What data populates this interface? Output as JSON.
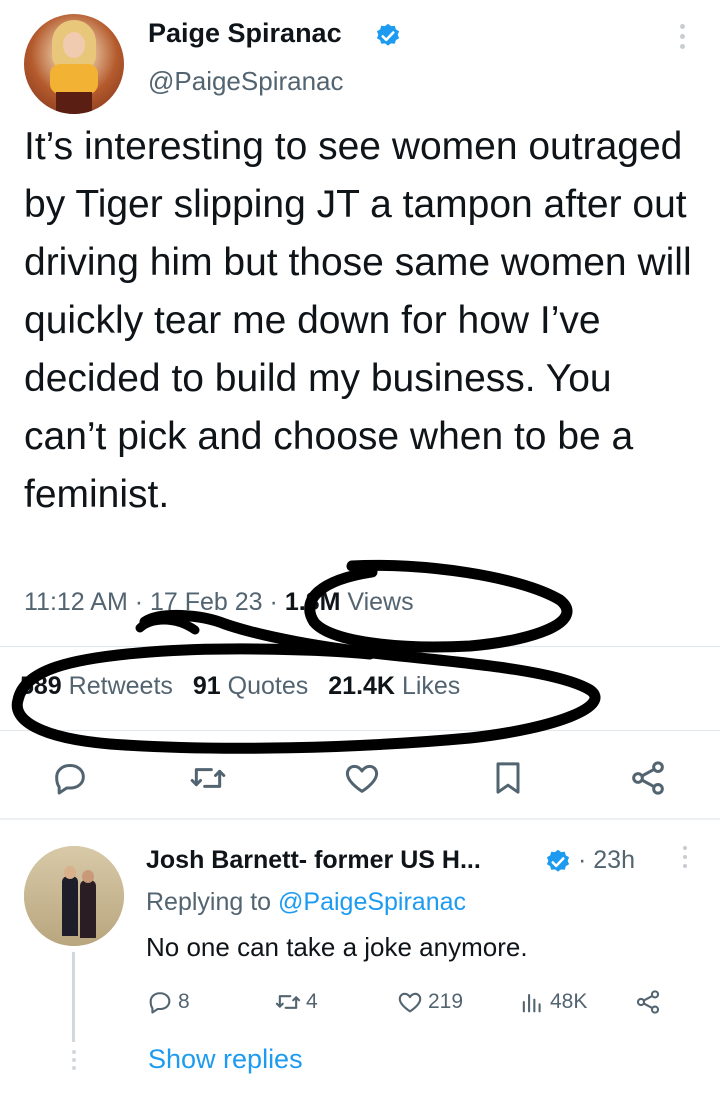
{
  "tweet": {
    "author_name": "Paige Spiranac",
    "handle": "@PaigeSpiranac",
    "text": "It’s interesting to see women outraged by Tiger slipping JT a tampon after out driving him but those same women will quickly tear me down for how I’ve decided to build my business. You can’t pick and choose when to be a feminist.",
    "time": "11:12 AM",
    "date_sep": " · ",
    "date": "17 Feb 23",
    "views_count": "1.8M",
    "views_label": "Views",
    "retweets_count": "589",
    "retweets_label": "Retweets",
    "quotes_count": "91",
    "quotes_label": "Quotes",
    "likes_count": "21.4K",
    "likes_label": "Likes"
  },
  "icons": {
    "reply": "reply-icon",
    "retweet": "retweet-icon",
    "like": "heart-icon",
    "bookmark": "bookmark-icon",
    "share": "share-icon",
    "verified": "verified-badge-icon",
    "views": "views-chart-icon"
  },
  "reply": {
    "author_name": "Josh Barnett- former US H...",
    "time_sep": "·",
    "time": "23h",
    "replying_prefix": "Replying to",
    "replying_mention": "@PaigeSpiranac",
    "text": "No one can take a joke anymore.",
    "replies_count": "8",
    "retweets_count": "4",
    "likes_count": "219",
    "views_count": "48K",
    "show_replies": "Show replies"
  },
  "colors": {
    "accent": "#1d9bf0",
    "text": "#0f1419",
    "secondary": "#536471",
    "annotation_ink": "#000000"
  }
}
